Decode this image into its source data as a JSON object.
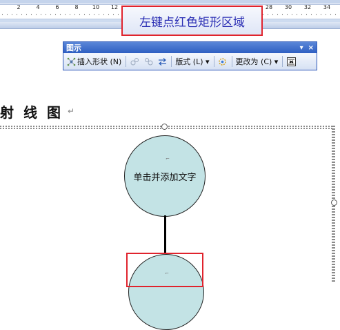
{
  "ruler": {
    "ticks": [
      "2",
      "4",
      "6",
      "8",
      "10",
      "12",
      "28",
      "30",
      "32",
      "34"
    ]
  },
  "callout": {
    "text": "左键点红色矩形区域"
  },
  "toolbar": {
    "title": "图示",
    "dropdown_glyph": "▾",
    "close_glyph": "×",
    "insert_shape": "插入形状 (N)",
    "layout": "版式 (L) ▾",
    "change_to": "更改为 (C) ▾"
  },
  "document": {
    "heading": "射线图",
    "para_mark": "↵"
  },
  "diagram": {
    "top_circle_text": "单击并添加文字"
  },
  "colors": {
    "callout_border": "#e0232d",
    "callout_text": "#2b2fb4",
    "circle_fill": "#c3e3e5",
    "titlebar": "#2e5fc2"
  }
}
